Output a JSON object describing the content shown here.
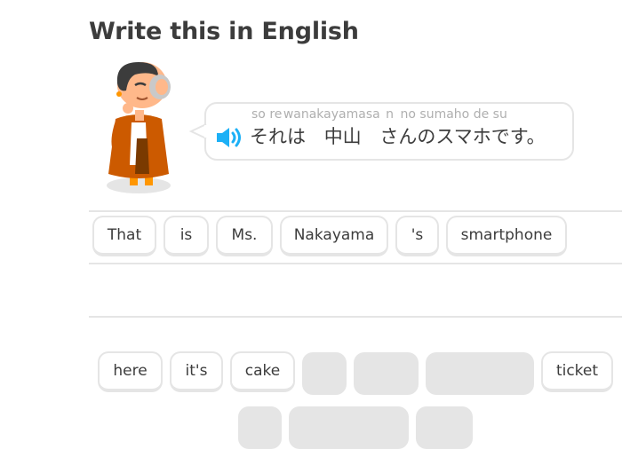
{
  "header": {
    "title": "Write this in English"
  },
  "prompt": {
    "romaji": [
      "so",
      "re",
      "wa",
      "nakayama",
      "sa",
      "n",
      "no",
      "su",
      "ma",
      "ho",
      "de",
      "su"
    ],
    "japanese": [
      "それは",
      "中山",
      "さんのスマホです。"
    ],
    "speaker_icon": "speaker-icon"
  },
  "answer_tiles": [
    "That",
    "is",
    "Ms.",
    "Nakayama",
    "'s",
    "smartphone"
  ],
  "word_bank": [
    "here",
    "it's",
    "cake",
    "ticket"
  ],
  "colors": {
    "speaker": "#1cb0f6",
    "border": "#e5e5e5",
    "slot": "#e5e5e5",
    "text": "#3c3c3c"
  }
}
